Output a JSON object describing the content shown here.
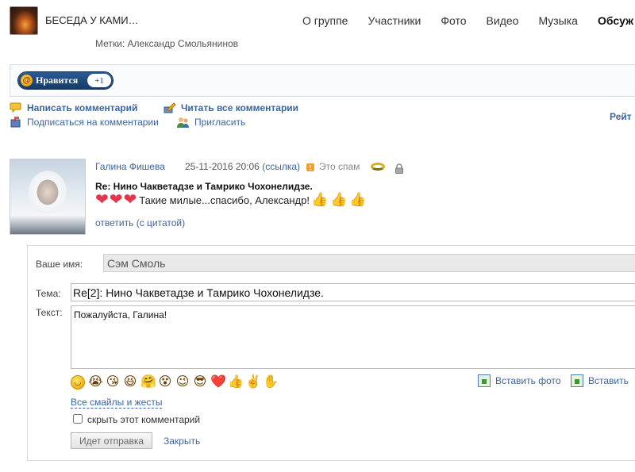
{
  "header": {
    "group_title": "БЕСЕДА У КАМИ…",
    "nav": [
      {
        "label": "О группе",
        "active": false
      },
      {
        "label": "Участники",
        "active": false
      },
      {
        "label": "Фото",
        "active": false
      },
      {
        "label": "Видео",
        "active": false
      },
      {
        "label": "Музыка",
        "active": false
      },
      {
        "label": "Обсуж",
        "active": true
      }
    ],
    "tags_prefix": "Метки:",
    "tags_value": "Александр Смольянинов"
  },
  "like": {
    "label": "Нравится",
    "count": "+1"
  },
  "actions": {
    "write_comment": "Написать комментарий",
    "read_all": "Читать все комментарии",
    "subscribe": "Подписаться на комментарии",
    "invite": "Пригласить",
    "rating": "Рейт"
  },
  "comment": {
    "author": "Галина Фишева",
    "datetime": "25-11-2016 20:06",
    "permalink": "(ссылка)",
    "spam": "Это спам",
    "subject": "Re: Нино Чакветадзе и Тамрико Чохонелидзе.",
    "text": "Такие милые...спасибо, Александр!",
    "reply": "ответить (с цитатой)"
  },
  "form": {
    "name_label": "Ваше имя:",
    "name_value": "Сэм Смоль",
    "topic_label": "Тема:",
    "topic_value": "Re[2]: Нино Чакветадзе и Тамрико Чохонелидзе.",
    "text_label": "Текст:",
    "text_value": "Пожалуйста, Галина!",
    "insert_photo": "Вставить фото",
    "insert_video": "Вставить",
    "all_smileys": "Все смайлы и жесты",
    "hide_comment": "скрыть этот комментарий",
    "send_button": "Идет отправка",
    "close": "Закрыть"
  },
  "colors": {
    "link": "#3a65a5",
    "like_button": "#1d4a80",
    "heart": "#e8344a"
  }
}
